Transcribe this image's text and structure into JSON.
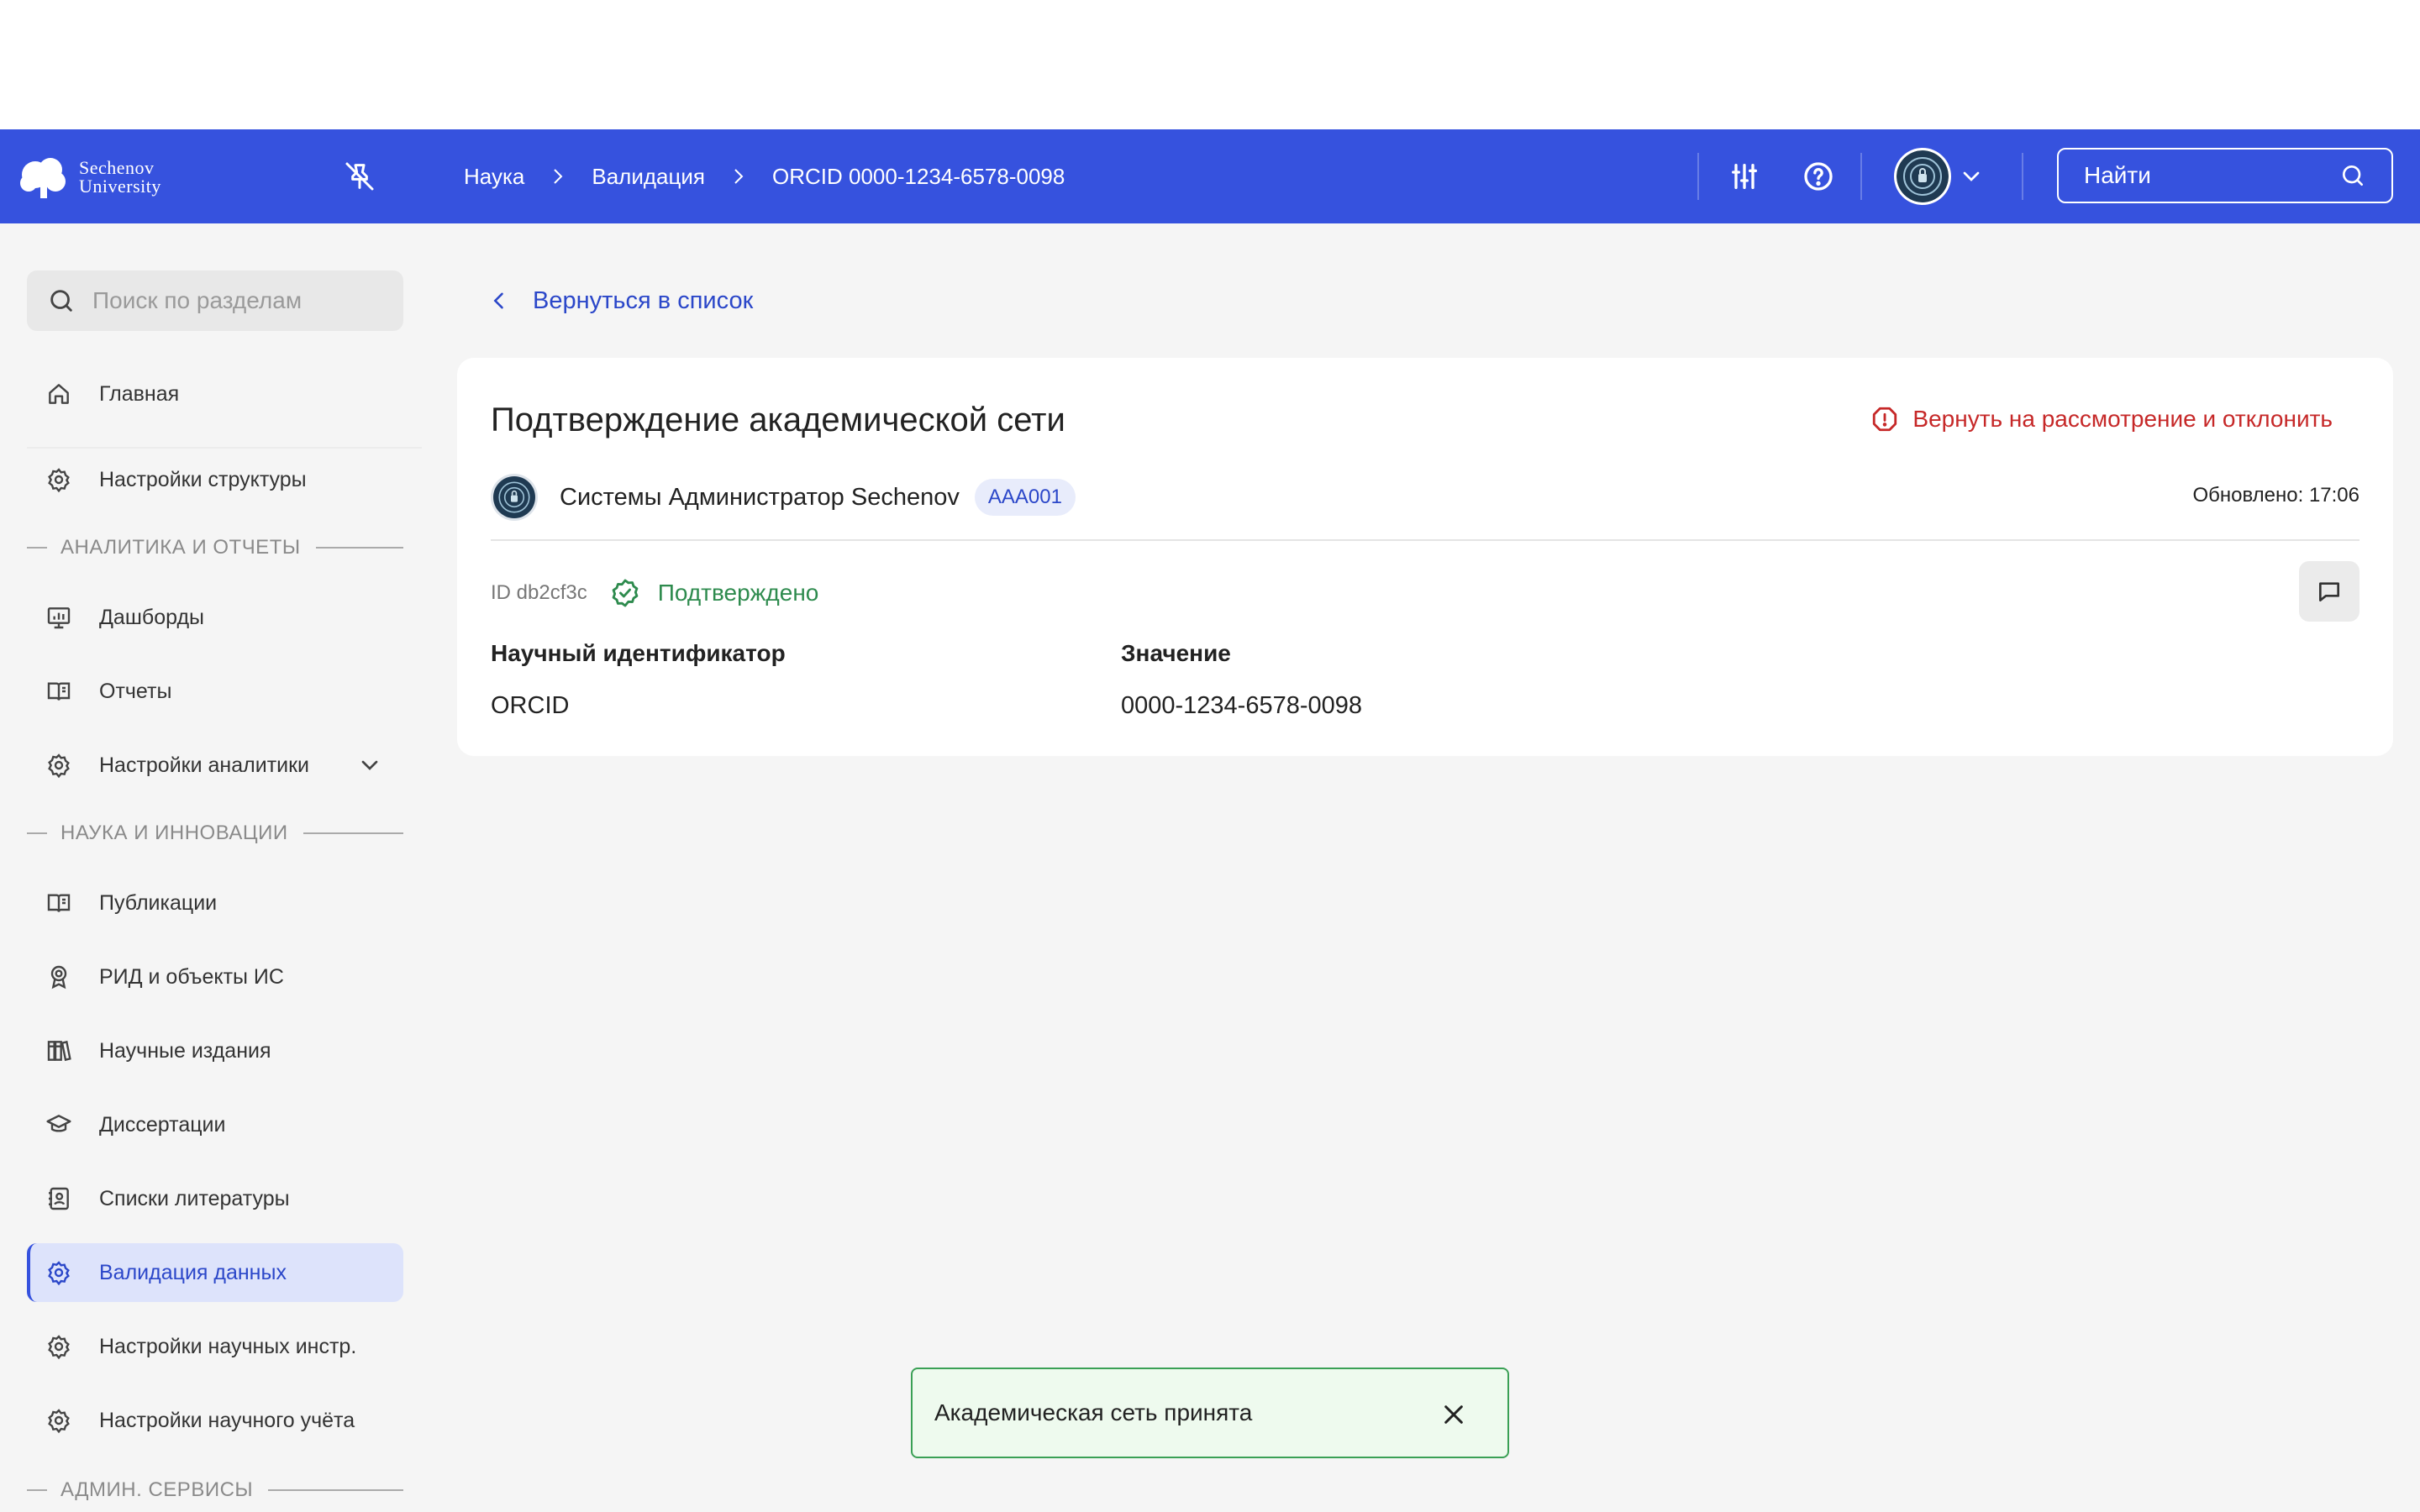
{
  "app": {
    "logo_line1": "Sechenov",
    "logo_line2": "University"
  },
  "header": {
    "breadcrumb": [
      "Наука",
      "Валидация",
      "ORCID 0000-1234-6578-0098"
    ],
    "search_label": "Найти",
    "icons": [
      "pin-off-icon",
      "sliders-icon",
      "help-icon",
      "avatar",
      "chevron-down-icon",
      "search-icon"
    ],
    "accent_color": "#3652de"
  },
  "sidebar": {
    "search_placeholder": "Поиск по разделам",
    "items": [
      {
        "label": "Главная",
        "icon": "home-icon"
      },
      {
        "label": "Настройки структуры",
        "icon": "gear-icon"
      },
      {
        "label": "Дашборды",
        "icon": "dashboard-icon"
      },
      {
        "label": "Отчеты",
        "icon": "report-icon"
      },
      {
        "label": "Настройки аналитики",
        "icon": "gear-icon"
      },
      {
        "label": "Публикации",
        "icon": "book-icon"
      },
      {
        "label": "РИД и объекты ИС",
        "icon": "award-icon"
      },
      {
        "label": "Научные издания",
        "icon": "library-icon"
      },
      {
        "label": "Диссертации",
        "icon": "graduation-cap-icon"
      },
      {
        "label": "Списки литературы",
        "icon": "contacts-book-icon"
      },
      {
        "label": "Валидация данных",
        "icon": "gear-icon",
        "active": true
      },
      {
        "label": "Настройки научных инстр.",
        "icon": "gear-icon"
      },
      {
        "label": "Настройки научного учёта",
        "icon": "gear-icon"
      }
    ],
    "sections": [
      "АНАЛИТИКА И ОТЧЕТЫ",
      "НАУКА И ИННОВАЦИИ",
      "АДМИН. СЕРВИСЫ"
    ],
    "active_color": "#dde3fb"
  },
  "main": {
    "back_label": "Вернуться в список",
    "card": {
      "title": "Подтверждение академической сети",
      "reject_label": "Вернуть на рассмотрение и отклонить",
      "author": "Системы Администратор Sechenov",
      "badge": "AAA001",
      "updated": "Обновлено: 17:06",
      "id": "ID db2cf3c",
      "status": "Подтверждено",
      "status_color": "#2e8b4e",
      "columns": [
        "Научный идентификатор",
        "Значение"
      ],
      "row": [
        "ORCID",
        "0000-1234-6578-0098"
      ]
    }
  },
  "toast": {
    "message": "Академическая сеть принята"
  }
}
